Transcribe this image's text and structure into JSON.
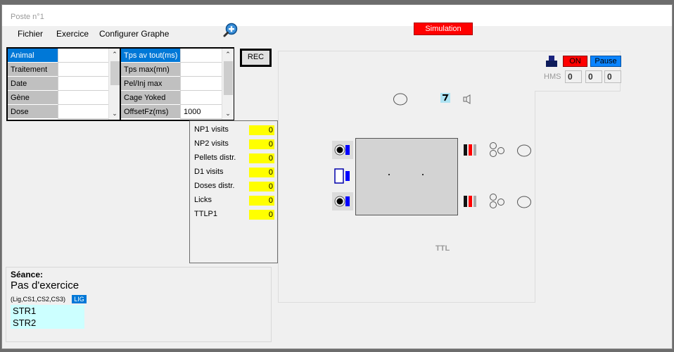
{
  "window": {
    "title": "Poste n°1"
  },
  "menu": {
    "items": [
      "Fichier",
      "Exercice",
      "Configurer Graphe"
    ]
  },
  "simulation_label": "Simulation",
  "left_table": {
    "rows": [
      {
        "label": "Animal",
        "value": ""
      },
      {
        "label": "Traitement",
        "value": ""
      },
      {
        "label": "Date",
        "value": ""
      },
      {
        "label": "Gène",
        "value": ""
      },
      {
        "label": "Dose",
        "value": ""
      }
    ]
  },
  "mid_table": {
    "rows": [
      {
        "label": "Tps av tout(ms)",
        "value": ""
      },
      {
        "label": "Tps max(mn)",
        "value": ""
      },
      {
        "label": "Pel/Inj max",
        "value": ""
      },
      {
        "label": "Cage Yoked",
        "value": ""
      },
      {
        "label": "OffsetFz(ms)",
        "value": "1000"
      }
    ]
  },
  "rec_label": "REC",
  "counts": [
    {
      "label": "NP1 visits",
      "value": "0"
    },
    {
      "label": "NP2 visits",
      "value": "0"
    },
    {
      "label": "Pellets distr.",
      "value": "0"
    },
    {
      "label": "D1 visits",
      "value": "0"
    },
    {
      "label": "Doses distr.",
      "value": "0"
    },
    {
      "label": "Licks",
      "value": "0"
    },
    {
      "label": "TTLP1",
      "value": "0"
    }
  ],
  "seance": {
    "title": "Séance:",
    "exercise": "Pas d'exercice",
    "cs_list": "(Lig,CS1,CS2,CS3)",
    "lig_badge": "LIG",
    "streams": [
      "STR1",
      "STR2"
    ]
  },
  "cage": {
    "ttl_label": "TTL"
  },
  "controls": {
    "on_label": "ON",
    "pause_label": "Pause",
    "hms_label": "HMS",
    "hms_values": [
      "0",
      "0",
      "0"
    ]
  },
  "colors": {
    "simulation": "#ff0000",
    "on": "#ff0000",
    "pause": "#0a84ff",
    "selected_row": "#0078d7",
    "count_bg": "#ffff00",
    "stream_bg": "#ccffff"
  }
}
